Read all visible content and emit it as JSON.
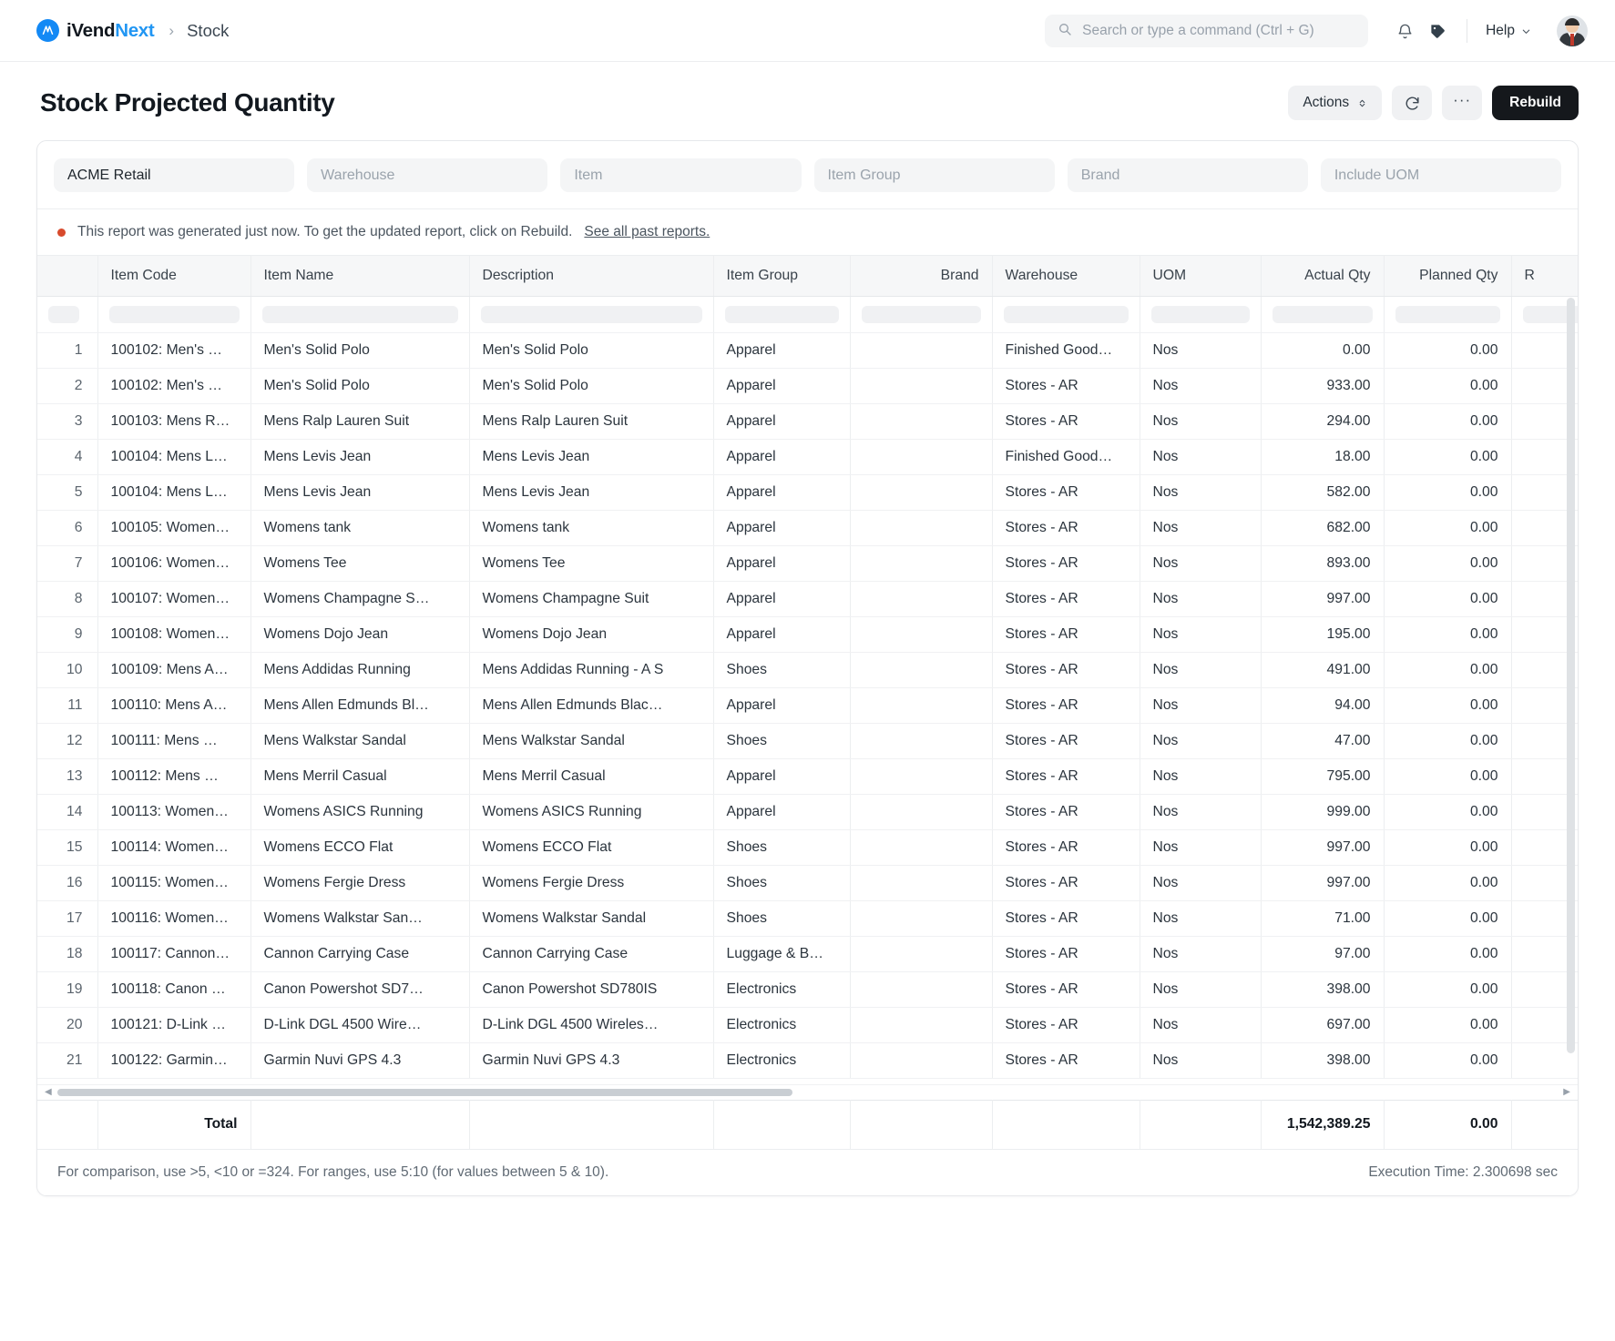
{
  "navbar": {
    "brand_first": "iVend",
    "brand_second": "Next",
    "brand_mark": "M",
    "breadcrumb_sep": "›",
    "breadcrumb": "Stock",
    "search_placeholder": "Search or type a command (Ctrl + G)",
    "search_icon": "search-icon",
    "notifications_icon": "bell-icon",
    "tag_icon": "tag-icon",
    "help_label": "Help",
    "help_caret": "⌄"
  },
  "page": {
    "title": "Stock Projected Quantity",
    "actions_label": "Actions",
    "actions_caret": "↕",
    "refresh_icon": "refresh-icon",
    "more_label": "···",
    "rebuild_label": "Rebuild"
  },
  "filters": [
    {
      "name": "company",
      "value": "ACME Retail",
      "filled": true
    },
    {
      "name": "warehouse",
      "value": "Warehouse",
      "filled": false
    },
    {
      "name": "item",
      "value": "Item",
      "filled": false
    },
    {
      "name": "item-group",
      "value": "Item Group",
      "filled": false
    },
    {
      "name": "brand",
      "value": "Brand",
      "filled": false
    },
    {
      "name": "include-uom",
      "value": "Include UOM",
      "filled": false
    }
  ],
  "notice": {
    "text": "This report was generated just now. To get the updated report, click on Rebuild.",
    "link": "See all past reports."
  },
  "table": {
    "columns": [
      "",
      "Item Code",
      "Item Name",
      "Description",
      "Item Group",
      "Brand",
      "Warehouse",
      "UOM",
      "Actual Qty",
      "Planned Qty",
      "R"
    ],
    "rows": [
      {
        "idx": "1",
        "code": "100102: Men's …",
        "name": "Men's Solid Polo",
        "desc": "Men's Solid Polo",
        "group": "Apparel",
        "brand": "",
        "wh": "Finished Good…",
        "uom": "Nos",
        "actual": "0.00",
        "planned": "0.00"
      },
      {
        "idx": "2",
        "code": "100102: Men's …",
        "name": "Men's Solid Polo",
        "desc": "Men's Solid Polo",
        "group": "Apparel",
        "brand": "",
        "wh": "Stores - AR",
        "uom": "Nos",
        "actual": "933.00",
        "planned": "0.00"
      },
      {
        "idx": "3",
        "code": "100103: Mens R…",
        "name": "Mens Ralp Lauren Suit",
        "desc": "Mens Ralp Lauren Suit",
        "group": "Apparel",
        "brand": "",
        "wh": "Stores - AR",
        "uom": "Nos",
        "actual": "294.00",
        "planned": "0.00"
      },
      {
        "idx": "4",
        "code": "100104: Mens L…",
        "name": "Mens Levis Jean",
        "desc": "Mens Levis Jean",
        "group": "Apparel",
        "brand": "",
        "wh": "Finished Good…",
        "uom": "Nos",
        "actual": "18.00",
        "planned": "0.00"
      },
      {
        "idx": "5",
        "code": "100104: Mens L…",
        "name": "Mens Levis Jean",
        "desc": "Mens Levis Jean",
        "group": "Apparel",
        "brand": "",
        "wh": "Stores - AR",
        "uom": "Nos",
        "actual": "582.00",
        "planned": "0.00"
      },
      {
        "idx": "6",
        "code": "100105: Women…",
        "name": "Womens tank",
        "desc": "Womens tank",
        "group": "Apparel",
        "brand": "",
        "wh": "Stores - AR",
        "uom": "Nos",
        "actual": "682.00",
        "planned": "0.00"
      },
      {
        "idx": "7",
        "code": "100106: Women…",
        "name": "Womens Tee",
        "desc": "Womens Tee",
        "group": "Apparel",
        "brand": "",
        "wh": "Stores - AR",
        "uom": "Nos",
        "actual": "893.00",
        "planned": "0.00"
      },
      {
        "idx": "8",
        "code": "100107: Women…",
        "name": "Womens Champagne S…",
        "desc": "Womens Champagne Suit",
        "group": "Apparel",
        "brand": "",
        "wh": "Stores - AR",
        "uom": "Nos",
        "actual": "997.00",
        "planned": "0.00"
      },
      {
        "idx": "9",
        "code": "100108: Women…",
        "name": "Womens Dojo Jean",
        "desc": "Womens Dojo Jean",
        "group": "Apparel",
        "brand": "",
        "wh": "Stores - AR",
        "uom": "Nos",
        "actual": "195.00",
        "planned": "0.00"
      },
      {
        "idx": "10",
        "code": "100109: Mens A…",
        "name": "Mens Addidas Running",
        "desc": "Mens Addidas Running - A S",
        "group": "Shoes",
        "brand": "",
        "wh": "Stores - AR",
        "uom": "Nos",
        "actual": "491.00",
        "planned": "0.00"
      },
      {
        "idx": "11",
        "code": "100110: Mens A…",
        "name": "Mens Allen Edmunds Bl…",
        "desc": "Mens Allen Edmunds Blac…",
        "group": "Apparel",
        "brand": "",
        "wh": "Stores - AR",
        "uom": "Nos",
        "actual": "94.00",
        "planned": "0.00"
      },
      {
        "idx": "12",
        "code": "100111: Mens …",
        "name": "Mens Walkstar Sandal",
        "desc": "Mens Walkstar Sandal",
        "group": "Shoes",
        "brand": "",
        "wh": "Stores - AR",
        "uom": "Nos",
        "actual": "47.00",
        "planned": "0.00"
      },
      {
        "idx": "13",
        "code": "100112: Mens …",
        "name": "Mens Merril Casual",
        "desc": "Mens Merril Casual",
        "group": "Apparel",
        "brand": "",
        "wh": "Stores - AR",
        "uom": "Nos",
        "actual": "795.00",
        "planned": "0.00"
      },
      {
        "idx": "14",
        "code": "100113: Women…",
        "name": "Womens ASICS Running",
        "desc": "Womens ASICS Running",
        "group": "Apparel",
        "brand": "",
        "wh": "Stores - AR",
        "uom": "Nos",
        "actual": "999.00",
        "planned": "0.00"
      },
      {
        "idx": "15",
        "code": "100114: Women…",
        "name": "Womens ECCO Flat",
        "desc": "Womens ECCO Flat",
        "group": "Shoes",
        "brand": "",
        "wh": "Stores - AR",
        "uom": "Nos",
        "actual": "997.00",
        "planned": "0.00"
      },
      {
        "idx": "16",
        "code": "100115: Women…",
        "name": "Womens Fergie Dress",
        "desc": "Womens Fergie Dress",
        "group": "Shoes",
        "brand": "",
        "wh": "Stores - AR",
        "uom": "Nos",
        "actual": "997.00",
        "planned": "0.00"
      },
      {
        "idx": "17",
        "code": "100116: Women…",
        "name": "Womens Walkstar San…",
        "desc": "Womens Walkstar Sandal",
        "group": "Shoes",
        "brand": "",
        "wh": "Stores - AR",
        "uom": "Nos",
        "actual": "71.00",
        "planned": "0.00"
      },
      {
        "idx": "18",
        "code": "100117: Cannon…",
        "name": "Cannon Carrying Case",
        "desc": "Cannon Carrying Case",
        "group": "Luggage & B…",
        "brand": "",
        "wh": "Stores - AR",
        "uom": "Nos",
        "actual": "97.00",
        "planned": "0.00"
      },
      {
        "idx": "19",
        "code": "100118: Canon …",
        "name": "Canon Powershot SD7…",
        "desc": "Canon Powershot SD780IS",
        "group": "Electronics",
        "brand": "",
        "wh": "Stores - AR",
        "uom": "Nos",
        "actual": "398.00",
        "planned": "0.00"
      },
      {
        "idx": "20",
        "code": "100121: D-Link …",
        "name": "D-Link DGL 4500 Wire…",
        "desc": "D-Link DGL 4500 Wireles…",
        "group": "Electronics",
        "brand": "",
        "wh": "Stores - AR",
        "uom": "Nos",
        "actual": "697.00",
        "planned": "0.00"
      },
      {
        "idx": "21",
        "code": "100122: Garmin…",
        "name": "Garmin Nuvi GPS 4.3",
        "desc": "Garmin Nuvi GPS 4.3",
        "group": "Electronics",
        "brand": "",
        "wh": "Stores - AR",
        "uom": "Nos",
        "actual": "398.00",
        "planned": "0.00"
      }
    ],
    "total": {
      "label": "Total",
      "actual": "1,542,389.25",
      "planned": "0.00"
    }
  },
  "footer": {
    "hint": "For comparison, use >5, <10 or =324. For ranges, use 5:10 (for values between 5 & 10).",
    "execution_time": "Execution Time: 2.300698 sec"
  },
  "colors": {
    "accent": "#2196f3",
    "notice_dot": "#d84a2c",
    "rebuild_bg": "#15181c"
  }
}
